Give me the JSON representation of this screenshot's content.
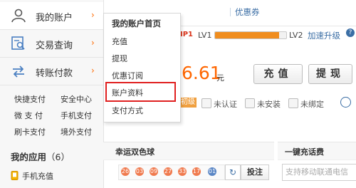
{
  "sidebar": {
    "nav": [
      {
        "label": "我的账户",
        "chevron": "›"
      },
      {
        "label": "交易查询",
        "chevron": "›"
      },
      {
        "label": "转账付款",
        "chevron": "›"
      }
    ],
    "quick_links": [
      "快捷支付",
      "安全中心",
      "微 支 付",
      "手机支付",
      "刷卡支付",
      "境外支付"
    ],
    "apps": {
      "title": "我的应用",
      "count": "（6）",
      "items": [
        "手机充值"
      ]
    }
  },
  "dropdown": {
    "header": "我的账户首页",
    "items": [
      "充值",
      "提现",
      "优惠订阅",
      "账户资料",
      "支付方式"
    ],
    "highlighted": "账户资料",
    "highlight_color": "#e02020"
  },
  "main": {
    "top_link": "优惠券",
    "vip_fragment": "IP1",
    "level_from": "LV1",
    "level_to": "LV2",
    "upgrade_link": "加速升级",
    "help_icon": "?",
    "progress": 0.9,
    "balance": "6.61",
    "balance_unit": "元",
    "recharge_button": "充值",
    "withdraw_button": "提现",
    "level_badge": "初级",
    "statuses": [
      "未认证",
      "未安装",
      "未绑定"
    ],
    "lottery": {
      "title": "幸运双色球",
      "red_balls": [
        "26",
        "03",
        "09",
        "27",
        "33",
        "17"
      ],
      "blue_balls": [
        "01"
      ],
      "refresh_icon": "↻",
      "bet_button": "投注"
    },
    "topup": {
      "title": "一键充话费",
      "placeholder": "支持移动联通电信"
    },
    "accent_orange": "#ff6600",
    "accent_blue": "#3b6ea5"
  }
}
